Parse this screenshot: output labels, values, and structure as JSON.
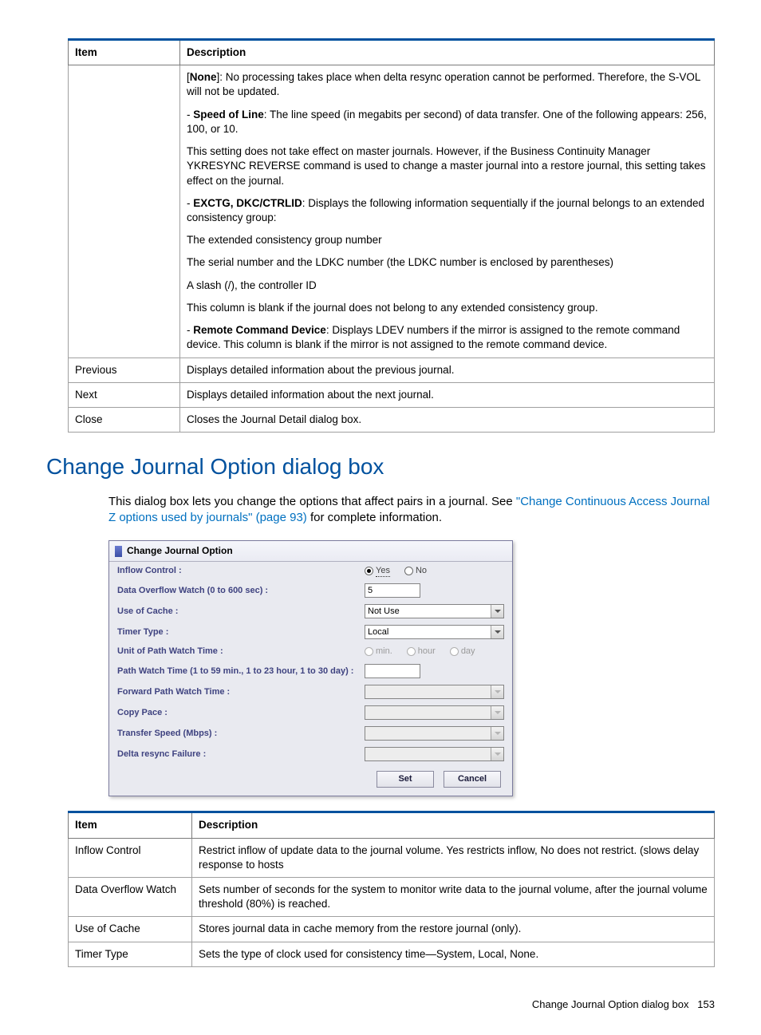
{
  "table1": {
    "headers": {
      "item": "Item",
      "description": "Description"
    },
    "rows": [
      {
        "item": "",
        "blocks": [
          {
            "pre": "[",
            "bold": "None",
            "post": "]: No processing takes place when delta resync operation cannot be performed. Therefore, the S-VOL will not be updated."
          },
          {
            "pre": "- ",
            "bold": "Speed of Line",
            "post": ": The line speed (in megabits per second) of data transfer. One of the following appears: 256, 100, or 10."
          },
          {
            "plain": "This setting does not take effect on master journals. However, if the Business Continuity Manager YKRESYNC REVERSE command is used to change a master journal into a restore journal, this setting takes effect on the journal."
          },
          {
            "pre": "- ",
            "bold": "EXCTG, DKC/CTRLID",
            "post": ": Displays the following information sequentially if the journal belongs to an extended consistency group:"
          },
          {
            "plain": "The extended consistency group number"
          },
          {
            "plain": "The serial number and the LDKC number (the LDKC number is enclosed by parentheses)"
          },
          {
            "plain": "A slash (/), the controller ID"
          },
          {
            "plain": "This column is blank if the journal does not belong to any extended consistency group."
          },
          {
            "pre": "- ",
            "bold": "Remote Command Device",
            "post": ": Displays LDEV numbers if the mirror is assigned to the remote command device. This column is blank if the mirror is not assigned to the remote command device."
          }
        ]
      },
      {
        "item": "Previous",
        "text": "Displays detailed information about the previous journal."
      },
      {
        "item": "Next",
        "text": "Displays detailed information about the next journal."
      },
      {
        "item": "Close",
        "text": "Closes the Journal Detail dialog box."
      }
    ]
  },
  "section": {
    "title": "Change Journal Option dialog box",
    "intro_pre": "This dialog box lets you change the options that affect pairs in a journal. See ",
    "intro_link": "\"Change Continuous Access Journal Z options used by journals\" (page 93)",
    "intro_post": " for complete information."
  },
  "dialog": {
    "title": "Change Journal Option",
    "rows": {
      "inflow": {
        "label": "Inflow Control :",
        "yes": "Yes",
        "no": "No"
      },
      "overflow": {
        "label": "Data Overflow Watch (0 to 600 sec) :",
        "value": "5"
      },
      "cache": {
        "label": "Use of Cache :",
        "value": "Not Use"
      },
      "timer": {
        "label": "Timer Type :",
        "value": "Local"
      },
      "unit": {
        "label": "Unit of Path Watch Time :",
        "min": "min.",
        "hour": "hour",
        "day": "day"
      },
      "pathwatch": {
        "label": "Path Watch Time (1 to 59 min., 1 to 23 hour, 1 to 30 day) :",
        "value": ""
      },
      "fwd": {
        "label": "Forward Path Watch Time :",
        "value": ""
      },
      "copypace": {
        "label": "Copy Pace :",
        "value": ""
      },
      "speed": {
        "label": "Transfer Speed (Mbps) :",
        "value": ""
      },
      "delta": {
        "label": "Delta resync Failure :",
        "value": ""
      }
    },
    "buttons": {
      "set": "Set",
      "cancel": "Cancel"
    }
  },
  "table2": {
    "headers": {
      "item": "Item",
      "description": "Description"
    },
    "rows": [
      {
        "item": "Inflow Control",
        "desc": "Restrict inflow of update data to the journal volume. Yes restricts inflow, No does not restrict. (slows delay response to hosts"
      },
      {
        "item": "Data Overflow Watch",
        "desc": "Sets number of seconds for the system to monitor write data to the journal volume, after the journal volume threshold (80%) is reached."
      },
      {
        "item": "Use of Cache",
        "desc": "Stores journal data in cache memory from the restore journal (only)."
      },
      {
        "item": "Timer Type",
        "desc": "Sets the type of clock used for consistency time—System, Local, None."
      }
    ]
  },
  "footer": {
    "text": "Change Journal Option dialog box",
    "page": "153"
  }
}
